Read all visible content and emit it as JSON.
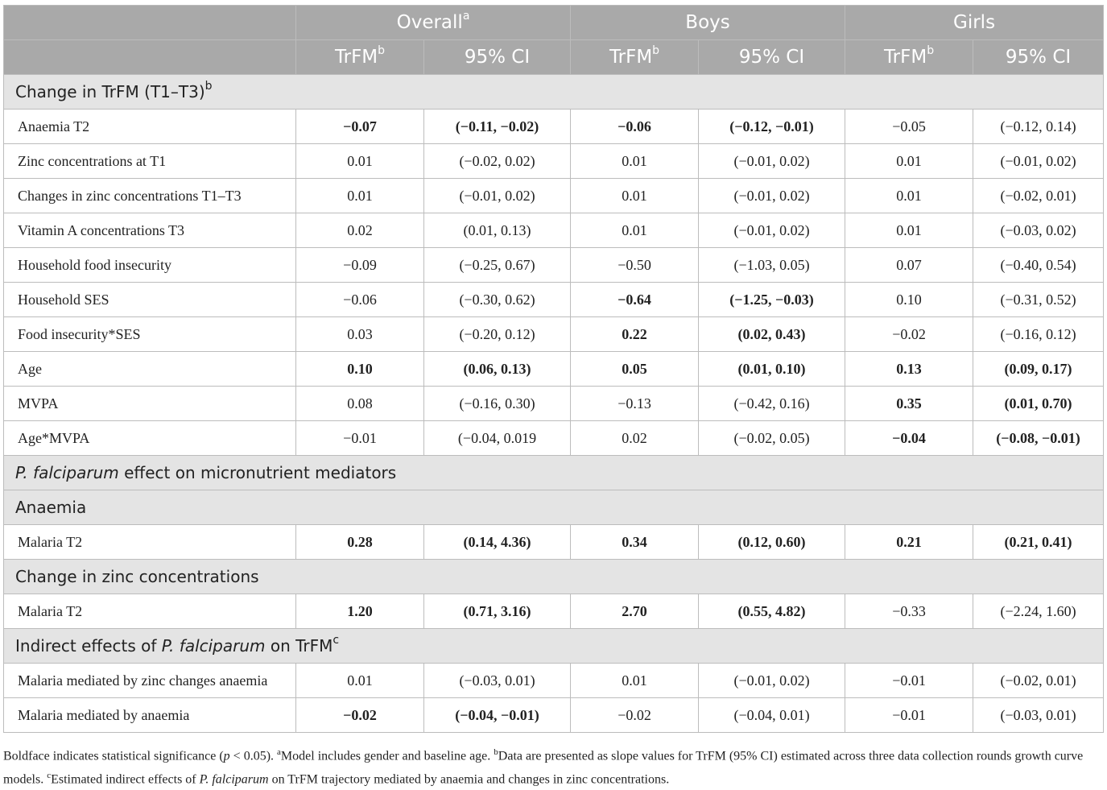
{
  "groups": {
    "overall": "Overall",
    "overall_sup": "a",
    "boys": "Boys",
    "girls": "Girls"
  },
  "subheaders": {
    "est": "TrFM",
    "est_sup": "b",
    "ci": "95% CI"
  },
  "sections": {
    "s1": {
      "title": "Change in TrFM (T1–T3)",
      "sup": "b"
    },
    "s2": {
      "title_italic": "P. falciparum",
      "title_rest": " effect on micronutrient mediators"
    },
    "s3": {
      "title": "Anaemia"
    },
    "s4": {
      "title": "Change in zinc concentrations"
    },
    "s5": {
      "title_pre": "Indirect effects of ",
      "title_italic": "P. falciparum",
      "title_post": " on TrFM",
      "sup": "c"
    }
  },
  "rows": [
    {
      "label": "Anaemia T2",
      "cells": [
        "−0.07",
        "(−0.11, −0.02)",
        "−0.06",
        "(−0.12, −0.01)",
        "−0.05",
        "(−0.12, 0.14)"
      ]
    },
    {
      "label": "Zinc concentrations at T1",
      "cells": [
        "0.01",
        "(−0.02, 0.02)",
        "0.01",
        "(−0.01, 0.02)",
        "0.01",
        "(−0.01, 0.02)"
      ]
    },
    {
      "label": "Changes in zinc concentrations T1–T3",
      "cells": [
        "0.01",
        "(−0.01, 0.02)",
        "0.01",
        "(−0.01, 0.02)",
        "0.01",
        "(−0.02, 0.01)"
      ]
    },
    {
      "label": "Vitamin A concentrations T3",
      "cells": [
        "0.02",
        "(0.01, 0.13)",
        "0.01",
        "(−0.01, 0.02)",
        "0.01",
        "(−0.03, 0.02)"
      ]
    },
    {
      "label": "Household food insecurity",
      "cells": [
        "−0.09",
        "(−0.25, 0.67)",
        "−0.50",
        "(−1.03, 0.05)",
        "0.07",
        "(−0.40, 0.54)"
      ]
    },
    {
      "label": "Household SES",
      "cells": [
        "−0.06",
        "(−0.30, 0.62)",
        "−0.64",
        "(−1.25, −0.03)",
        "0.10",
        "(−0.31, 0.52)"
      ]
    },
    {
      "label": "Food insecurity*SES",
      "cells": [
        "0.03",
        "(−0.20, 0.12)",
        "0.22",
        "(0.02, 0.43)",
        "−0.02",
        "(−0.16, 0.12)"
      ]
    },
    {
      "label": "Age",
      "cells": [
        "0.10",
        "(0.06, 0.13)",
        "0.05",
        "(0.01, 0.10)",
        "0.13",
        "(0.09, 0.17)"
      ]
    },
    {
      "label": "MVPA",
      "cells": [
        "0.08",
        "(−0.16, 0.30)",
        "−0.13",
        "(−0.42, 0.16)",
        "0.35",
        "(0.01, 0.70)"
      ]
    },
    {
      "label": "Age*MVPA",
      "cells": [
        "−0.01",
        "(−0.04, 0.019",
        "0.02",
        "(−0.02, 0.05)",
        "−0.04",
        "(−0.08, −0.01)"
      ]
    },
    {
      "label": "Malaria T2",
      "cells": [
        "0.28",
        "(0.14, 4.36)",
        "0.34",
        "(0.12, 0.60)",
        "0.21",
        "(0.21, 0.41)"
      ]
    },
    {
      "label": "Malaria T2",
      "cells": [
        "1.20",
        "(0.71, 3.16)",
        "2.70",
        "(0.55, 4.82)",
        "−0.33",
        "(−2.24, 1.60)"
      ]
    },
    {
      "label": "Malaria mediated by zinc changes anaemia",
      "cells": [
        "0.01",
        "(−0.03, 0.01)",
        "0.01",
        "(−0.01, 0.02)",
        "−0.01",
        "(−0.02, 0.01)"
      ]
    },
    {
      "label": "Malaria mediated by anaemia",
      "cells": [
        "−0.02",
        "(−0.04, −0.01)",
        "−0.02",
        "(−0.04, 0.01)",
        "−0.01",
        "(−0.03, 0.01)"
      ]
    }
  ],
  "footnote": {
    "p1": "Boldface indicates statistical significance (",
    "p_italic": "p",
    "p2": " < 0.05). ",
    "a_sup": "a",
    "a_text": "Model includes gender and baseline age. ",
    "b_sup": "b",
    "b_text": "Data are presented as slope values for TrFM (95% CI) estimated across three data collection rounds growth curve models. ",
    "c_sup": "c",
    "c_text1": "Estimated indirect effects of ",
    "c_italic": "P. falciparum",
    "c_text2": " on TrFM trajectory mediated by anaemia and changes in zinc concentrations."
  }
}
